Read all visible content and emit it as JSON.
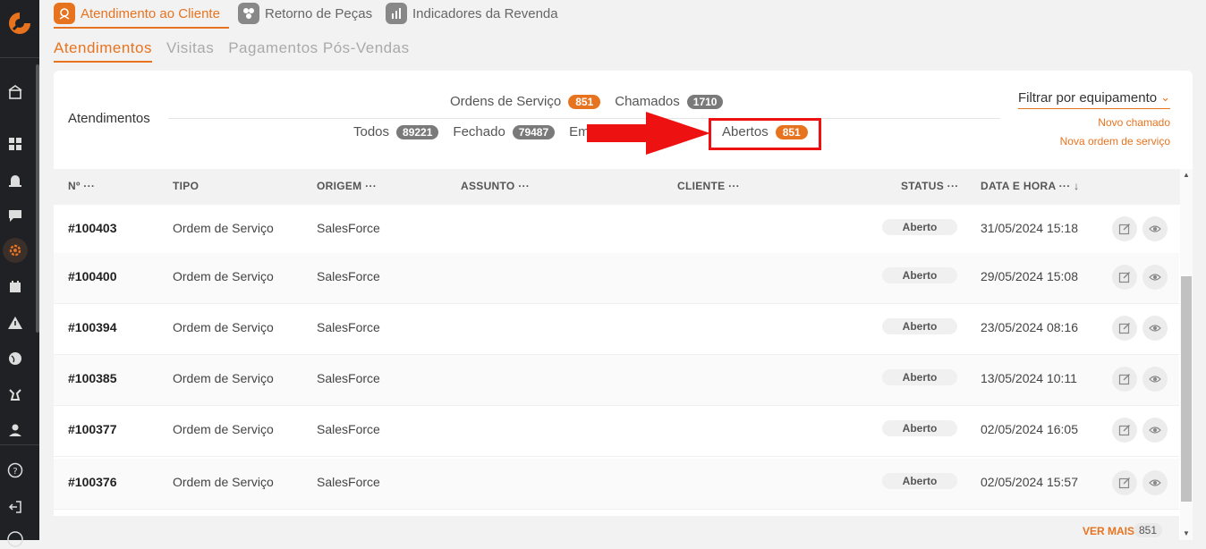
{
  "top_tabs": [
    {
      "label": "Atendimento ao Cliente",
      "icon": "support-icon",
      "active": true
    },
    {
      "label": "Retorno de Peças",
      "icon": "parts-icon",
      "active": false
    },
    {
      "label": "Indicadores da Revenda",
      "icon": "chart-icon",
      "active": false
    }
  ],
  "sub_tabs": [
    {
      "label": "Atendimentos",
      "active": true
    },
    {
      "label": "Visitas",
      "active": false
    },
    {
      "label": "Pagamentos Pós-Vendas",
      "active": false
    }
  ],
  "card": {
    "title": "Atendimentos",
    "type_filters": [
      {
        "label": "Ordens de Serviço",
        "count": "851",
        "color": "#e8731f"
      },
      {
        "label": "Chamados",
        "count": "1710",
        "color": "#7a7a7a"
      }
    ],
    "status_filters": [
      {
        "label": "Todos",
        "count": "89221"
      },
      {
        "label": "Fechado",
        "count": "79487"
      },
      {
        "label": "Em"
      },
      {
        "label": "Abertos",
        "count": "851",
        "color": "#e8731f"
      }
    ],
    "equipment_filter": "Filtrar por equipamento",
    "new_call": "Novo chamado",
    "new_order": "Nova ordem de serviço"
  },
  "table": {
    "columns": [
      "Nº",
      "TIPO",
      "ORIGEM",
      "ASSUNTO",
      "CLIENTE",
      "STATUS",
      "DATA E HORA"
    ],
    "column_menu_glyph": "···",
    "sort_glyph": "↓",
    "rows": [
      {
        "num": "#100403",
        "tipo": "Ordem de Serviço",
        "origem": "SalesForce",
        "status": "Aberto",
        "data": "31/05/2024 15:18"
      },
      {
        "num": "#100400",
        "tipo": "Ordem de Serviço",
        "origem": "SalesForce",
        "status": "Aberto",
        "data": "29/05/2024 15:08"
      },
      {
        "num": "#100394",
        "tipo": "Ordem de Serviço",
        "origem": "SalesForce",
        "status": "Aberto",
        "data": "23/05/2024 08:16"
      },
      {
        "num": "#100385",
        "tipo": "Ordem de Serviço",
        "origem": "SalesForce",
        "status": "Aberto",
        "data": "13/05/2024 10:11"
      },
      {
        "num": "#100377",
        "tipo": "Ordem de Serviço",
        "origem": "SalesForce",
        "status": "Aberto",
        "data": "02/05/2024 16:05"
      },
      {
        "num": "#100376",
        "tipo": "Ordem de Serviço",
        "origem": "SalesForce",
        "status": "Aberto",
        "data": "02/05/2024 15:57"
      }
    ],
    "see_more": "VER MAIS",
    "total": "851"
  },
  "colors": {
    "accent": "#e8731f",
    "annotation": "#ee1111",
    "sidebar": "#1f2125"
  }
}
